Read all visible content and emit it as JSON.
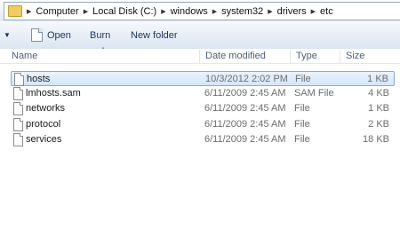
{
  "breadcrumb": [
    "Computer",
    "Local Disk (C:)",
    "windows",
    "system32",
    "drivers",
    "etc"
  ],
  "toolbar": {
    "open_label": "Open",
    "burn_label": "Burn",
    "new_folder_label": "New folder"
  },
  "columns": {
    "name": "Name",
    "date": "Date modified",
    "type": "Type",
    "size": "Size"
  },
  "files": [
    {
      "name": "hosts",
      "date": "10/3/2012 2:02 PM",
      "type": "File",
      "size": "1 KB",
      "selected": true
    },
    {
      "name": "lmhosts.sam",
      "date": "6/11/2009 2:45 AM",
      "type": "SAM File",
      "size": "4 KB"
    },
    {
      "name": "networks",
      "date": "6/11/2009 2:45 AM",
      "type": "File",
      "size": "1 KB"
    },
    {
      "name": "protocol",
      "date": "6/11/2009 2:45 AM",
      "type": "File",
      "size": "2 KB"
    },
    {
      "name": "services",
      "date": "6/11/2009 2:45 AM",
      "type": "File",
      "size": "18 KB"
    }
  ],
  "colors": {
    "selection": "#d4e6fb",
    "selection_border": "#84acdd",
    "toolbar_text": "#1c3258"
  },
  "icons": {
    "folder": "folder-icon",
    "file": "file-icon",
    "breadcrumb_arrow": "chevron-right-icon",
    "organize": "chevron-down-icon"
  }
}
